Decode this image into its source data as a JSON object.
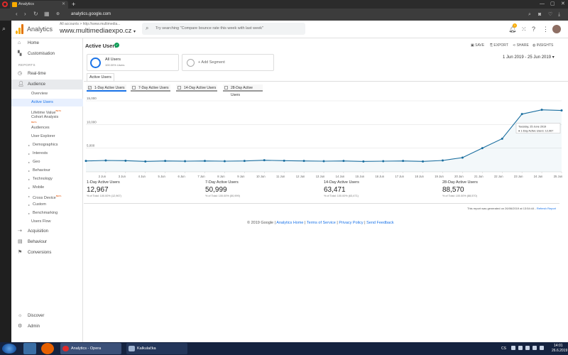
{
  "browser": {
    "tab_title": "Analytics",
    "url": "analytics.google.com"
  },
  "ga": {
    "app_name": "Analytics",
    "account_path": "All accounts > http://www.multimedia...",
    "account_name": "www.multimediaexpo.cz",
    "search_placeholder": "Try searching \"Compare bounce rate this week with last week\"",
    "notifications_count": "1"
  },
  "nav": {
    "top": [
      {
        "label": "Home",
        "icon": "home-icon"
      },
      {
        "label": "Customisation",
        "icon": "customisation-icon"
      }
    ],
    "reports_label": "REPORTS",
    "realtime": "Real-time",
    "audience": "Audience",
    "audience_sub": [
      {
        "label": "Overview"
      },
      {
        "label": "Active Users"
      },
      {
        "label": "Lifetime Value",
        "beta": "BETA"
      },
      {
        "label": "Cohort Analysis",
        "beta": "BETA"
      },
      {
        "label": "Audiences"
      },
      {
        "label": "User Explorer"
      },
      {
        "label": "Demographics"
      },
      {
        "label": "Interests"
      },
      {
        "label": "Geo"
      },
      {
        "label": "Behaviour"
      },
      {
        "label": "Technology"
      },
      {
        "label": "Mobile"
      },
      {
        "label": "Cross Device",
        "beta": "BETA"
      },
      {
        "label": "Custom"
      },
      {
        "label": "Benchmarking"
      },
      {
        "label": "Users Flow"
      }
    ],
    "acquisition": "Acquisition",
    "behaviour": "Behaviour",
    "conversions": "Conversions",
    "discover": "Discover",
    "admin": "Admin"
  },
  "report": {
    "title": "Active Users",
    "actions": {
      "save": "SAVE",
      "export": "EXPORT",
      "share": "SHARE",
      "insights": "INSIGHTS"
    },
    "date_range": "1 Jun 2019 - 25 Jun 2019",
    "segment": {
      "name": "All Users",
      "pct": "100.00% Users",
      "add": "+ Add Segment"
    },
    "tab": "Active Users",
    "metric_buttons": [
      {
        "label": "1-Day Active Users",
        "checked": true
      },
      {
        "label": "7-Day Active Users",
        "checked": false
      },
      {
        "label": "14-Day Active Users",
        "checked": false
      },
      {
        "label": "28-Day Active Users",
        "checked": false
      }
    ],
    "tooltip": {
      "date": "Tuesday, 25 June 2019",
      "series": "1-Day Active Users: 12,967"
    },
    "stats": [
      {
        "label": "1-Day Active Users",
        "value": "12,967",
        "sub": "% of Total: 100.00% (12,967)"
      },
      {
        "label": "7-Day Active Users",
        "value": "50,999",
        "sub": "% of Total: 100.00% (50,999)"
      },
      {
        "label": "14-Day Active Users",
        "value": "63,471",
        "sub": "% of Total: 100.00% (63,471)"
      },
      {
        "label": "28-Day Active Users",
        "value": "88,570",
        "sub": "% of Total: 100.00% (88,570)"
      }
    ],
    "generated_note": "This report was generated on 26/06/2019 at 13:54:44 -",
    "refresh_label": "Refresh Report",
    "footer": {
      "copyright": "© 2019 Google |",
      "home": "Analytics Home",
      "terms": "Terms of Service",
      "privacy": "Privacy Policy",
      "feedback": "Send Feedback"
    }
  },
  "chart_data": {
    "type": "line",
    "x": [
      "1 Jun",
      "2 Jun",
      "3 Jun",
      "4 Jun",
      "5 Jun",
      "6 Jun",
      "7 Jun",
      "8 Jun",
      "9 Jun",
      "10 Jun",
      "11 Jun",
      "12 Jun",
      "13 Jun",
      "14 Jun",
      "15 Jun",
      "16 Jun",
      "17 Jun",
      "18 Jun",
      "19 Jun",
      "20 Jun",
      "21 Jun",
      "22 Jun",
      "23 Jun",
      "24 Jun",
      "25 Jun"
    ],
    "xticks": [
      "2 Jun",
      "3 Jun",
      "4 Jun",
      "5 Jun",
      "6 Jun",
      "7 Jun",
      "8 Jun",
      "9 Jun",
      "10 Jun",
      "11 Jun",
      "12 Jun",
      "13 Jun",
      "14 Jun",
      "15 Jun",
      "16 Jun",
      "17 Jun",
      "18 Jun",
      "19 Jun",
      "20 Jun",
      "21 Jun",
      "22 Jun",
      "23 Jun",
      "24 Jun",
      "25 Jun"
    ],
    "series": [
      {
        "name": "1-Day Active Users",
        "values": [
          2300,
          2400,
          2350,
          2200,
          2300,
          2250,
          2300,
          2250,
          2300,
          2450,
          2350,
          2300,
          2250,
          2300,
          2200,
          2250,
          2300,
          2200,
          2400,
          3000,
          5000,
          7000,
          12200,
          13100,
          12967
        ]
      }
    ],
    "yticks": [
      "5,000",
      "10,000",
      "15,000"
    ],
    "ylim": [
      0,
      15000
    ],
    "color": "#1a6e9f",
    "grid": true
  },
  "taskbar": {
    "windows": [
      {
        "label": "Analytics - Opera"
      },
      {
        "label": "Kalkulačka"
      }
    ],
    "lang": "CS",
    "time": "14:01",
    "date": "26.6.2019"
  }
}
